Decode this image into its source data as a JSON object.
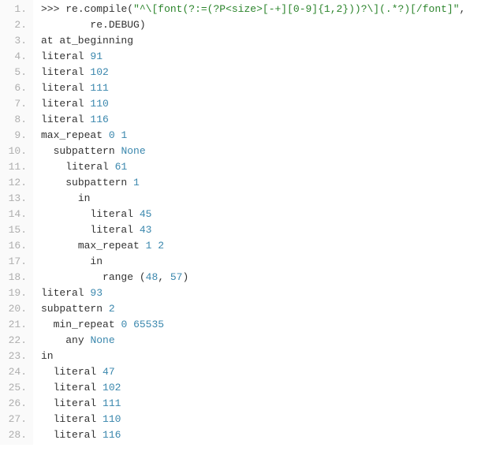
{
  "lines": [
    {
      "num": "1.",
      "tokens": [
        {
          "cls": "tok-prompt",
          "t": ">>> "
        },
        {
          "cls": "tok-kw",
          "t": "re"
        },
        {
          "cls": "tok-op",
          "t": "."
        },
        {
          "cls": "tok-kw",
          "t": "compile"
        },
        {
          "cls": "tok-paren",
          "t": "("
        },
        {
          "cls": "tok-str",
          "t": "\"^\\[font(?:=(?P<size>[-+][0-9]{1,2}))?\\](.*?)[/font]\""
        },
        {
          "cls": "tok-paren",
          "t": ","
        }
      ]
    },
    {
      "num": "2.",
      "tokens": [
        {
          "cls": "",
          "t": "        "
        },
        {
          "cls": "tok-kw",
          "t": "re"
        },
        {
          "cls": "tok-op",
          "t": "."
        },
        {
          "cls": "tok-kw",
          "t": "DEBUG"
        },
        {
          "cls": "tok-paren",
          "t": ")"
        }
      ]
    },
    {
      "num": "3.",
      "tokens": [
        {
          "cls": "tok-kw",
          "t": "at at_beginning"
        }
      ]
    },
    {
      "num": "4.",
      "tokens": [
        {
          "cls": "tok-kw",
          "t": "literal "
        },
        {
          "cls": "tok-num",
          "t": "91"
        }
      ]
    },
    {
      "num": "5.",
      "tokens": [
        {
          "cls": "tok-kw",
          "t": "literal "
        },
        {
          "cls": "tok-num",
          "t": "102"
        }
      ]
    },
    {
      "num": "6.",
      "tokens": [
        {
          "cls": "tok-kw",
          "t": "literal "
        },
        {
          "cls": "tok-num",
          "t": "111"
        }
      ]
    },
    {
      "num": "7.",
      "tokens": [
        {
          "cls": "tok-kw",
          "t": "literal "
        },
        {
          "cls": "tok-num",
          "t": "110"
        }
      ]
    },
    {
      "num": "8.",
      "tokens": [
        {
          "cls": "tok-kw",
          "t": "literal "
        },
        {
          "cls": "tok-num",
          "t": "116"
        }
      ]
    },
    {
      "num": "9.",
      "tokens": [
        {
          "cls": "tok-kw",
          "t": "max_repeat "
        },
        {
          "cls": "tok-num",
          "t": "0"
        },
        {
          "cls": "",
          "t": " "
        },
        {
          "cls": "tok-num",
          "t": "1"
        }
      ]
    },
    {
      "num": "10.",
      "tokens": [
        {
          "cls": "",
          "t": "  "
        },
        {
          "cls": "tok-kw",
          "t": "subpattern "
        },
        {
          "cls": "tok-none",
          "t": "None"
        }
      ]
    },
    {
      "num": "11.",
      "tokens": [
        {
          "cls": "",
          "t": "    "
        },
        {
          "cls": "tok-kw",
          "t": "literal "
        },
        {
          "cls": "tok-num",
          "t": "61"
        }
      ]
    },
    {
      "num": "12.",
      "tokens": [
        {
          "cls": "",
          "t": "    "
        },
        {
          "cls": "tok-kw",
          "t": "subpattern "
        },
        {
          "cls": "tok-num",
          "t": "1"
        }
      ]
    },
    {
      "num": "13.",
      "tokens": [
        {
          "cls": "",
          "t": "      "
        },
        {
          "cls": "tok-in",
          "t": "in"
        }
      ]
    },
    {
      "num": "14.",
      "tokens": [
        {
          "cls": "",
          "t": "        "
        },
        {
          "cls": "tok-kw",
          "t": "literal "
        },
        {
          "cls": "tok-num",
          "t": "45"
        }
      ]
    },
    {
      "num": "15.",
      "tokens": [
        {
          "cls": "",
          "t": "        "
        },
        {
          "cls": "tok-kw",
          "t": "literal "
        },
        {
          "cls": "tok-num",
          "t": "43"
        }
      ]
    },
    {
      "num": "16.",
      "tokens": [
        {
          "cls": "",
          "t": "      "
        },
        {
          "cls": "tok-kw",
          "t": "max_repeat "
        },
        {
          "cls": "tok-num",
          "t": "1"
        },
        {
          "cls": "",
          "t": " "
        },
        {
          "cls": "tok-num",
          "t": "2"
        }
      ]
    },
    {
      "num": "17.",
      "tokens": [
        {
          "cls": "",
          "t": "        "
        },
        {
          "cls": "tok-in",
          "t": "in"
        }
      ]
    },
    {
      "num": "18.",
      "tokens": [
        {
          "cls": "",
          "t": "          "
        },
        {
          "cls": "tok-kw",
          "t": "range "
        },
        {
          "cls": "tok-paren",
          "t": "("
        },
        {
          "cls": "tok-num",
          "t": "48"
        },
        {
          "cls": "tok-paren",
          "t": ", "
        },
        {
          "cls": "tok-num",
          "t": "57"
        },
        {
          "cls": "tok-paren",
          "t": ")"
        }
      ]
    },
    {
      "num": "19.",
      "tokens": [
        {
          "cls": "tok-kw",
          "t": "literal "
        },
        {
          "cls": "tok-num",
          "t": "93"
        }
      ]
    },
    {
      "num": "20.",
      "tokens": [
        {
          "cls": "tok-kw",
          "t": "subpattern "
        },
        {
          "cls": "tok-num",
          "t": "2"
        }
      ]
    },
    {
      "num": "21.",
      "tokens": [
        {
          "cls": "",
          "t": "  "
        },
        {
          "cls": "tok-kw",
          "t": "min_repeat "
        },
        {
          "cls": "tok-num",
          "t": "0"
        },
        {
          "cls": "",
          "t": " "
        },
        {
          "cls": "tok-num",
          "t": "65535"
        }
      ]
    },
    {
      "num": "22.",
      "tokens": [
        {
          "cls": "",
          "t": "    "
        },
        {
          "cls": "tok-kw",
          "t": "any "
        },
        {
          "cls": "tok-none",
          "t": "None"
        }
      ]
    },
    {
      "num": "23.",
      "tokens": [
        {
          "cls": "tok-in",
          "t": "in"
        }
      ]
    },
    {
      "num": "24.",
      "tokens": [
        {
          "cls": "",
          "t": "  "
        },
        {
          "cls": "tok-kw",
          "t": "literal "
        },
        {
          "cls": "tok-num",
          "t": "47"
        }
      ]
    },
    {
      "num": "25.",
      "tokens": [
        {
          "cls": "",
          "t": "  "
        },
        {
          "cls": "tok-kw",
          "t": "literal "
        },
        {
          "cls": "tok-num",
          "t": "102"
        }
      ]
    },
    {
      "num": "26.",
      "tokens": [
        {
          "cls": "",
          "t": "  "
        },
        {
          "cls": "tok-kw",
          "t": "literal "
        },
        {
          "cls": "tok-num",
          "t": "111"
        }
      ]
    },
    {
      "num": "27.",
      "tokens": [
        {
          "cls": "",
          "t": "  "
        },
        {
          "cls": "tok-kw",
          "t": "literal "
        },
        {
          "cls": "tok-num",
          "t": "110"
        }
      ]
    },
    {
      "num": "28.",
      "tokens": [
        {
          "cls": "",
          "t": "  "
        },
        {
          "cls": "tok-kw",
          "t": "literal "
        },
        {
          "cls": "tok-num",
          "t": "116"
        }
      ]
    }
  ]
}
